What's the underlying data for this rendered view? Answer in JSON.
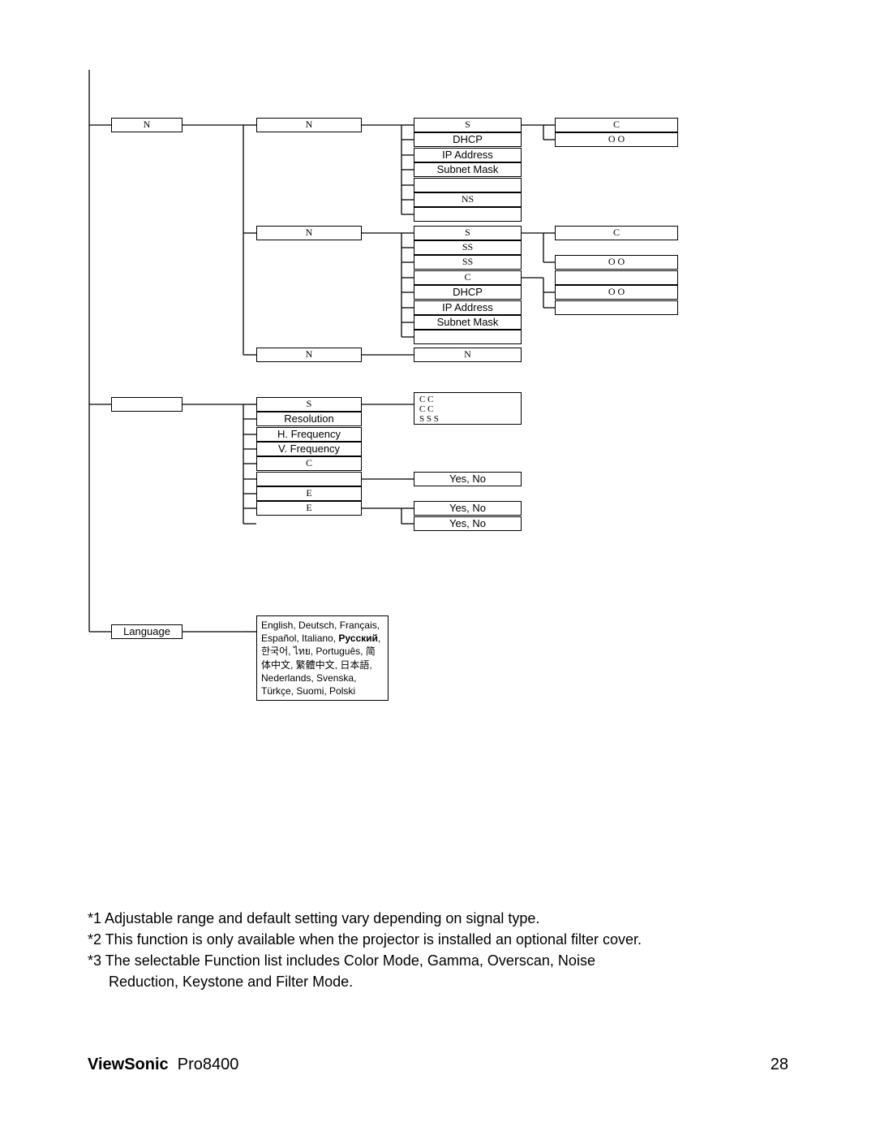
{
  "col1": {
    "n1": "N",
    "empty": "",
    "language": "Language"
  },
  "col2": {
    "n1": "N",
    "n2": "N",
    "n3": "N",
    "s": "S",
    "resolution": "Resolution",
    "hfreq": "H. Frequency",
    "vfreq": "V. Frequency",
    "c": "C",
    "empty1": "",
    "e1": "E",
    "e2": "E"
  },
  "col3": {
    "s1": "S",
    "dhcp": "DHCP",
    "ip": "IP Address",
    "subnet": "Subnet Mask",
    "empty1": "",
    "ns": "NS",
    "empty2": "",
    "s2": "S",
    "ss1": "SS",
    "ss2": "SS",
    "c": "C",
    "dhcp2": "DHCP",
    "ip2": "IP Address",
    "subnet2": "Subnet Mask",
    "empty3": "",
    "n": "N",
    "cc1": "C  C",
    "cc2": "C C",
    "sss": "S S  S",
    "yn1": "Yes, No",
    "yn2": "Yes, No",
    "yn3": "Yes, No"
  },
  "col4": {
    "c1": "C",
    "oo1": "O O",
    "c2": "C",
    "oo2": "O O",
    "empty": "",
    "oo3": "O O"
  },
  "languages": "English, Deutsch, Français, Español, Italiano, <b>Русский</b>, 한국어, ไทย, Português, 简体中文, 繁體中文, 日本語, Nederlands, Svenska, Türkçe, Suomi, Polski",
  "footnotes": {
    "n1": "*1 Adjustable range and default setting vary depending on signal type.",
    "n2": "*2 This function is only available when the projector is installed an optional filter cover.",
    "n3a": "*3 The selectable Function list includes Color Mode, Gamma, Overscan, Noise",
    "n3b": "Reduction, Keystone and Filter Mode."
  },
  "footer": {
    "brand": "ViewSonic",
    "model": "Pro8400",
    "page": "28"
  }
}
